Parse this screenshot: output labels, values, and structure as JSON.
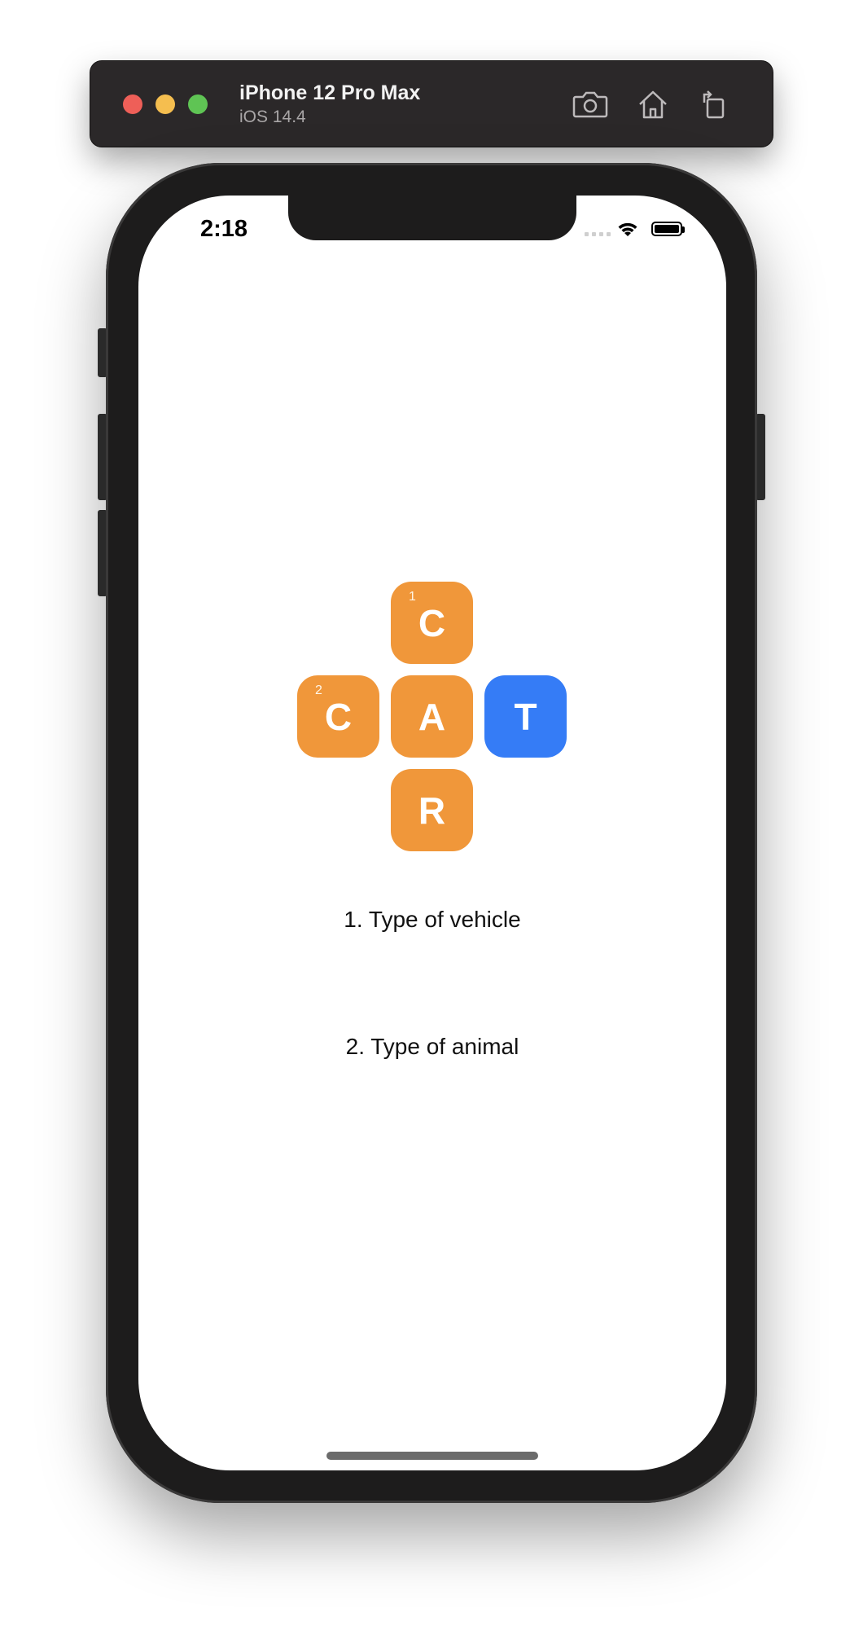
{
  "simulator": {
    "device_name": "iPhone 12 Pro Max",
    "os_version": "iOS 14.4",
    "toolbar_icons": [
      "screenshot-icon",
      "home-icon",
      "rotate-icon"
    ]
  },
  "status_bar": {
    "time": "2:18",
    "icons": [
      "cellular-signal-icon",
      "wifi-icon",
      "battery-icon"
    ]
  },
  "colors": {
    "tile_default": "#f0973a",
    "tile_selected": "#357cf6",
    "titlebar": "#2b2829"
  },
  "crossword": {
    "tiles": [
      {
        "letter": "C",
        "number": "1",
        "state": "default"
      },
      {
        "letter": "C",
        "number": "2",
        "state": "default"
      },
      {
        "letter": "A",
        "number": "",
        "state": "default"
      },
      {
        "letter": "T",
        "number": "",
        "state": "selected"
      },
      {
        "letter": "R",
        "number": "",
        "state": "default"
      }
    ]
  },
  "clues": [
    {
      "text": "1. Type of vehicle"
    },
    {
      "text": "2. Type of animal"
    }
  ]
}
